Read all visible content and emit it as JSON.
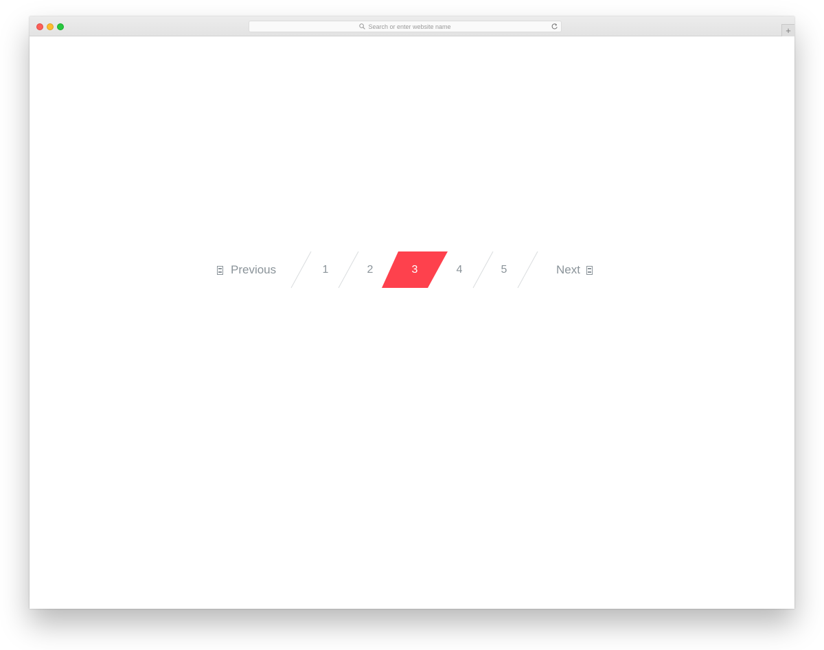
{
  "browser": {
    "address_placeholder": "Search or enter website name",
    "new_tab_label": "+",
    "icons": {
      "search": "search-icon",
      "reload": "reload-icon"
    }
  },
  "pagination": {
    "previous_label": "Previous",
    "next_label": "Next",
    "pages": [
      "1",
      "2",
      "3",
      "4",
      "5"
    ],
    "active_page": "3",
    "colors": {
      "active": "#fe414d",
      "text": "#8a9399",
      "divider": "#d9dcde"
    }
  }
}
